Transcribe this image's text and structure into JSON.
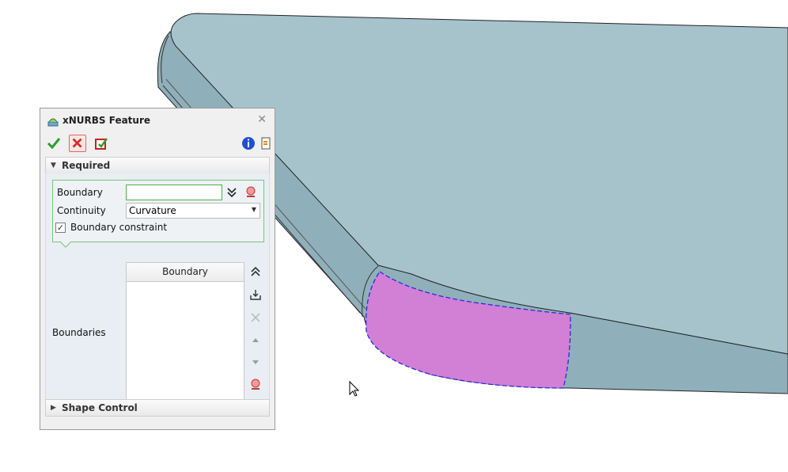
{
  "dialog": {
    "title": "xNURBS Feature",
    "close_glyph": "✕",
    "toolbar": {
      "ok_icon": "check-icon",
      "cancel_icon": "x-icon",
      "preview_icon": "preview-icon",
      "info_icon": "info-icon",
      "help_icon": "help-icon"
    }
  },
  "required": {
    "header": "Required",
    "boundary_label": "Boundary",
    "boundary_value": "",
    "continuity_label": "Continuity",
    "continuity_value": "Curvature",
    "boundary_constraint_label": "Boundary constraint",
    "boundary_constraint_checked": true,
    "boundaries_label": "Boundaries",
    "boundaries_column": "Boundary"
  },
  "shape_control": {
    "header": "Shape Control"
  },
  "colors": {
    "model_face": "#a6c3cc",
    "model_side": "#8fb0ba",
    "highlight_patch": "#d27fd6",
    "boundary_dash": "#2b2bd8",
    "panel_bg": "#f0f0f0",
    "group_border": "#7ec27e"
  }
}
